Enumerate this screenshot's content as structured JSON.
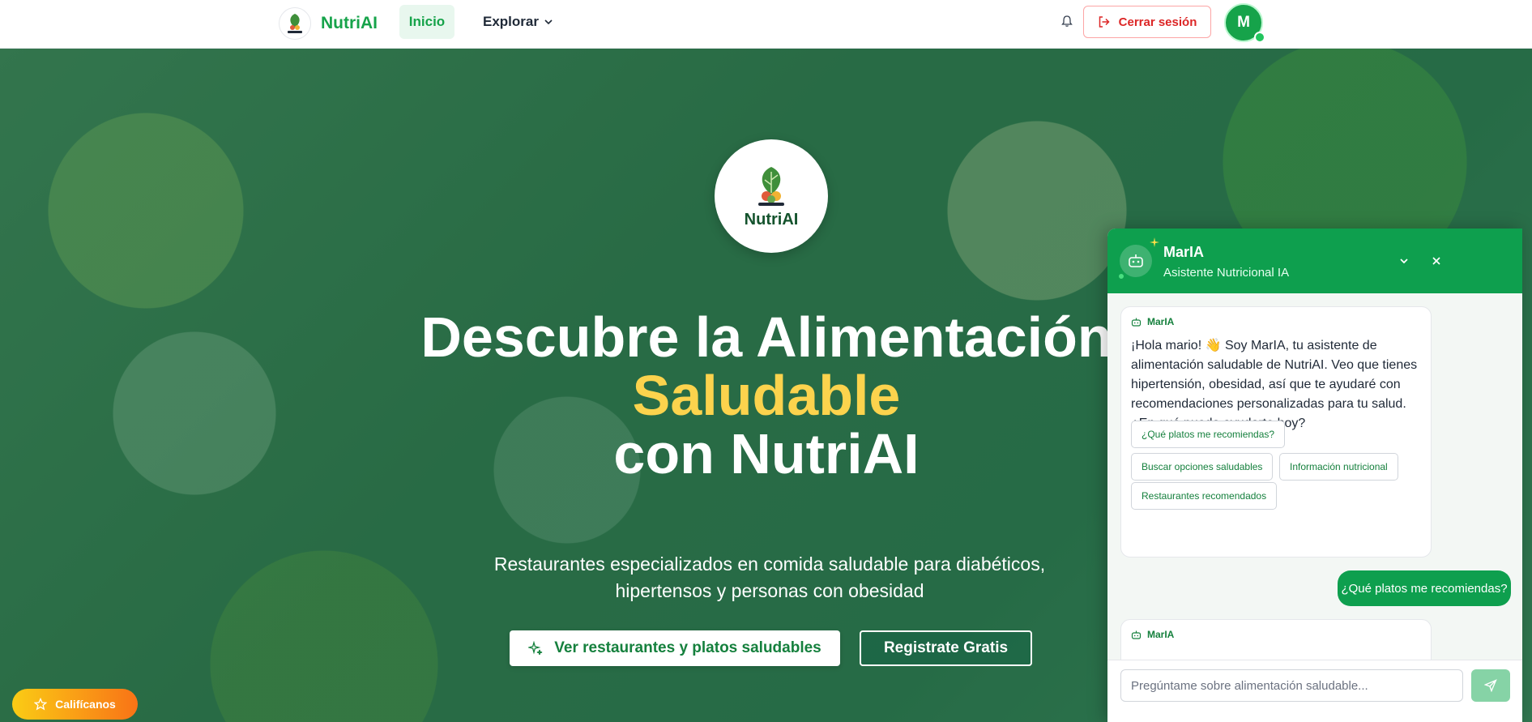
{
  "navbar": {
    "brand_name": "NutriAI",
    "logo_caption": "NutriAI",
    "nav_home": "Inicio",
    "nav_explore": "Explorar",
    "logout_label": "Cerrar sesión",
    "avatar_initial": "M"
  },
  "hero": {
    "logo_text": "NutriAI",
    "title_line1": "Descubre la Alimentación",
    "title_line2": "Saludable",
    "title_line3": "con NutriAI",
    "subtitle_line1": "Restaurantes especializados en comida saludable para diabéticos,",
    "subtitle_line2": "hipertensos y personas con obesidad",
    "cta_primary": "Ver restaurantes y platos saludables",
    "cta_secondary": "Registrate Gratis",
    "rate_button": "Califícanos"
  },
  "chat": {
    "assistant_name": "MarIA",
    "assistant_role": "Asistente Nutricional IA",
    "messages": [
      {
        "sender": "MarIA",
        "text": "¡Hola mario! 👋 Soy MarIA, tu asistente de alimentación saludable de NutriAI. Veo que tienes hipertensión, obesidad, así que te ayudaré con recomendaciones personalizadas para tu salud. ¿En qué puedo ayudarte hoy?",
        "quick_replies": [
          "¿Qué platos me recomiendas?",
          "Buscar opciones saludables",
          "Información nutricional",
          "Restaurantes recomendados"
        ]
      },
      {
        "sender": "user",
        "text": "¿Qué platos me recomiendas?"
      },
      {
        "sender": "MarIA",
        "text": ""
      }
    ],
    "input_placeholder": "Pregúntame sobre alimentación saludable...",
    "input_value": ""
  },
  "colors": {
    "brand_green": "#16a34a",
    "chat_green": "#0e9f4e",
    "accent_yellow": "#fcd34d",
    "logout_red": "#dc2626"
  },
  "icons": [
    "bell-icon",
    "logout-icon",
    "chevron-down-icon",
    "sparkles-icon",
    "bot-icon",
    "minimize-icon",
    "close-icon",
    "send-icon",
    "star-icon"
  ]
}
